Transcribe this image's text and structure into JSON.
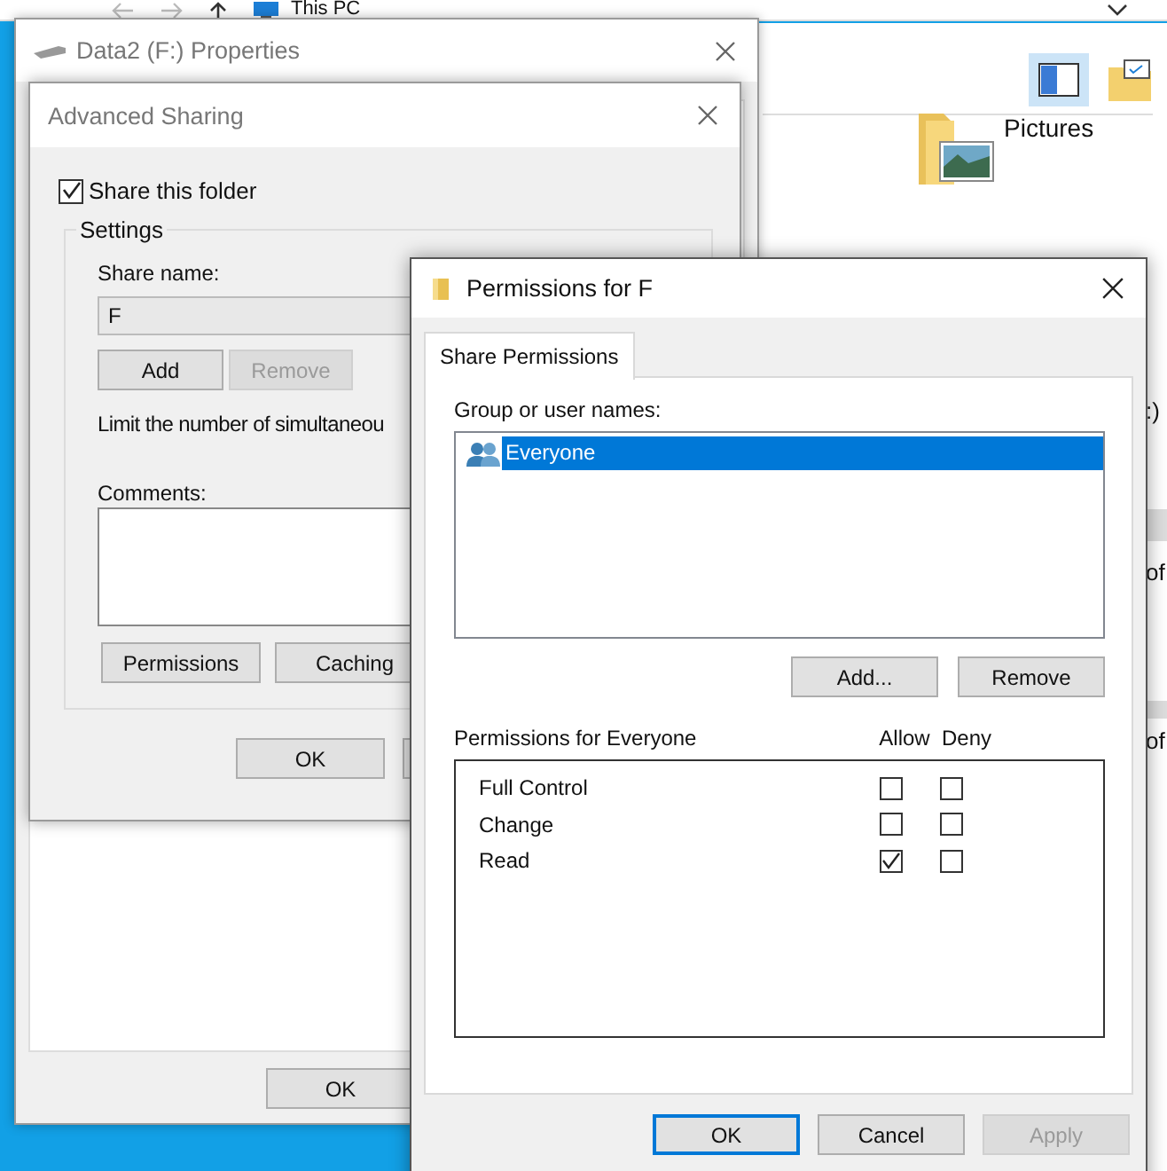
{
  "explorer": {
    "address": "This PC",
    "items": [
      {
        "label": "Pictures"
      }
    ],
    "fragments": [
      ":)",
      "of",
      "of"
    ]
  },
  "properties_window": {
    "title": "Data2 (F:) Properties",
    "buttons": [
      {
        "label": "OK"
      }
    ]
  },
  "advanced_sharing": {
    "title": "Advanced Sharing",
    "share_folder": {
      "label": "Share this folder",
      "checked": true
    },
    "settings": {
      "title": "Settings",
      "share_name_label": "Share name:",
      "share_name": "F",
      "buttons": [
        {
          "label": "Add",
          "disabled": false
        },
        {
          "label": "Remove",
          "disabled": true
        }
      ],
      "limit_text": "Limit the number of simultaneou",
      "comments_label": "Comments:",
      "lower_buttons": [
        {
          "label": "Permissions",
          "disabled": false
        },
        {
          "label": "Caching",
          "disabled": false
        }
      ]
    },
    "buttons": [
      {
        "label": "OK"
      }
    ]
  },
  "permissions": {
    "title": "Permissions for F",
    "tabs": [
      {
        "label": "Share Permissions",
        "selected": true
      }
    ],
    "group_label": "Group or user names:",
    "users": [
      {
        "name": "Everyone",
        "selected": true
      }
    ],
    "user_buttons": [
      {
        "label": "Add...",
        "disabled": false
      },
      {
        "label": "Remove",
        "disabled": false
      }
    ],
    "perm_label": "Permissions for Everyone",
    "columns": [
      "Allow",
      "Deny"
    ],
    "rows": [
      {
        "name": "Full Control",
        "allow": false,
        "deny": false
      },
      {
        "name": "Change",
        "allow": false,
        "deny": false
      },
      {
        "name": "Read",
        "allow": true,
        "deny": false
      }
    ],
    "buttons": [
      {
        "label": "OK",
        "default": true,
        "disabled": false
      },
      {
        "label": "Cancel",
        "default": false,
        "disabled": false
      },
      {
        "label": "Apply",
        "default": false,
        "disabled": true
      }
    ]
  }
}
